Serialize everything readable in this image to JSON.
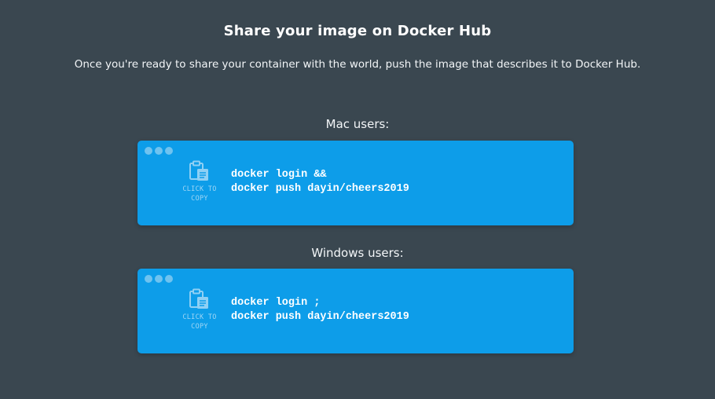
{
  "header": {
    "title": "Share your image on Docker Hub",
    "subtitle": "Once you're ready to share your container with the world, push the image that describes it to Docker Hub."
  },
  "sections": [
    {
      "label": "Mac users:",
      "copy_label": "CLICK TO\nCOPY",
      "copy_icon": "clipboard-icon",
      "code_lines": [
        "docker login &&",
        "docker push dayin/cheers2019"
      ]
    },
    {
      "label": "Windows users:",
      "copy_label": "CLICK TO\nCOPY",
      "copy_icon": "clipboard-icon",
      "code_lines": [
        "docker login ;",
        "docker push dayin/cheers2019"
      ]
    }
  ],
  "colors": {
    "background": "#3a4750",
    "terminal": "#0d9de9",
    "terminal_dots": "#6fc3f0",
    "copy_text": "#9fd6f5"
  }
}
